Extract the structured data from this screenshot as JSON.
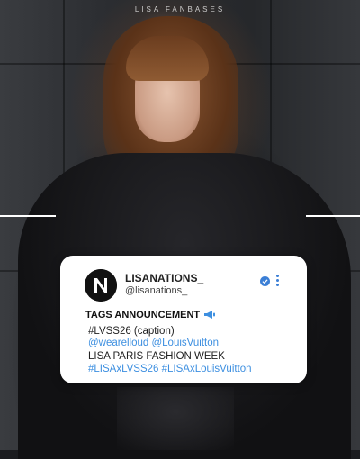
{
  "header": {
    "watermark": "LISA FANBASES"
  },
  "post": {
    "account_name": "LISANATIONS_",
    "handle": "@lisanations_",
    "avatar_letter": "N",
    "title": "TAGS ANNOUNCEMENT",
    "title_icon": "megaphone-icon",
    "lines": [
      "#LVSS26 (caption)",
      "@wearelloud @LouisVuitton",
      "LISA PARIS FASHION WEEK",
      "#LISAxLVSS26 #LISAxLouisVuitton"
    ]
  },
  "colors": {
    "link": "#3d8fe0",
    "verified": "#3b7fd6",
    "card_bg": "#ffffff"
  }
}
